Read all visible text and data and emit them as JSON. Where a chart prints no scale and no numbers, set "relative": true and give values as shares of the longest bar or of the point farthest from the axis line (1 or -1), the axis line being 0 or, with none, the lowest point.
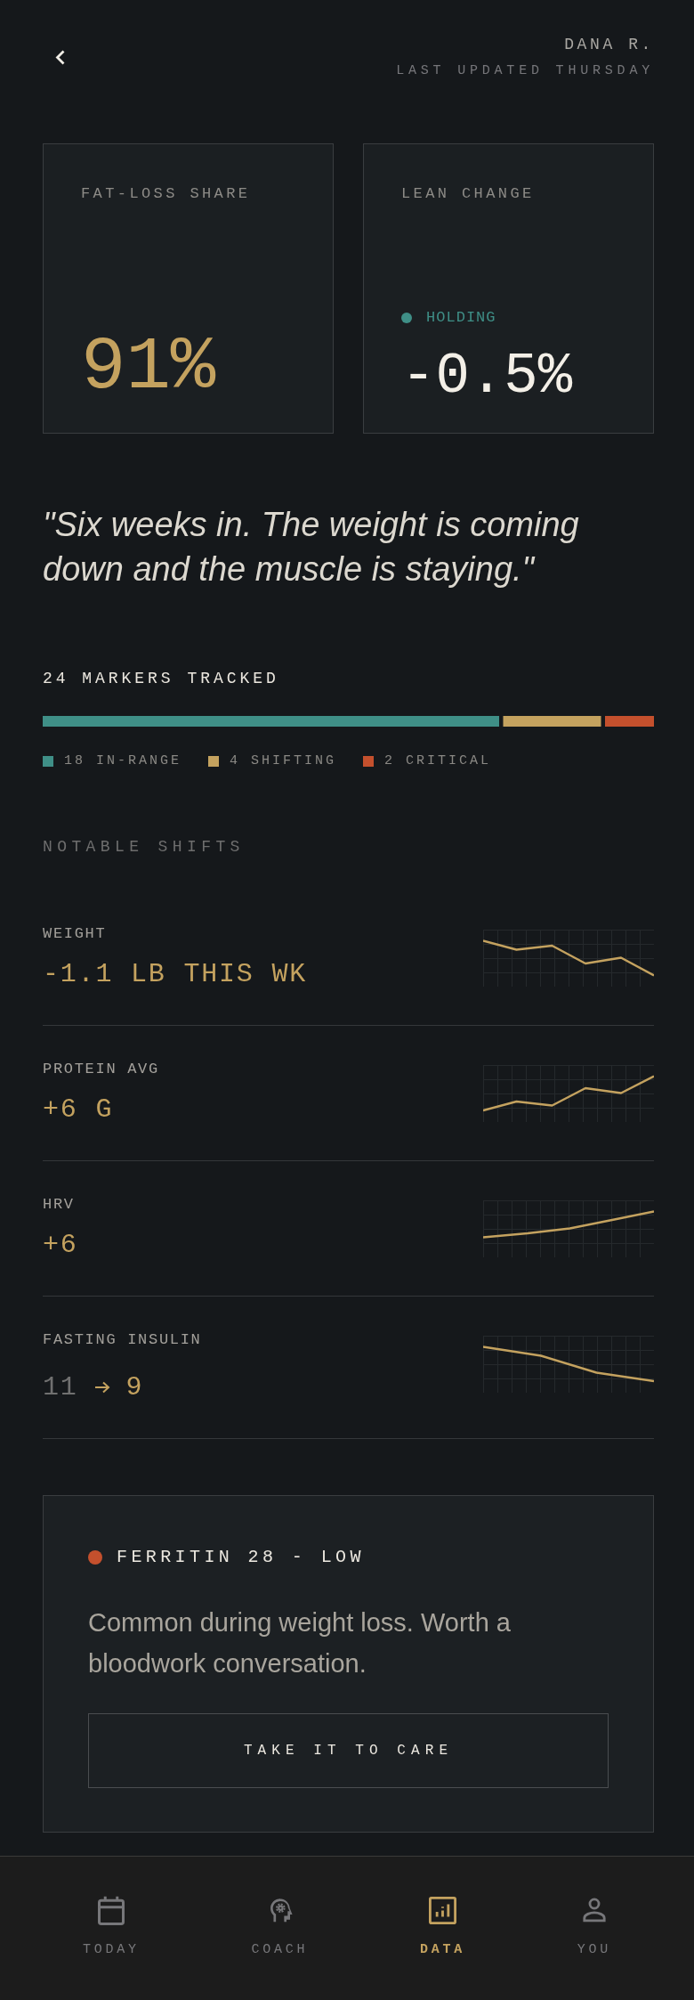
{
  "header": {
    "name": "DANA R.",
    "subtitle": "LAST UPDATED THURSDAY"
  },
  "stats": [
    {
      "kind": "highlight",
      "label": "FAT-LOSS SHARE",
      "value": "91%"
    },
    {
      "kind": "status",
      "label": "LEAN CHANGE",
      "status": {
        "label": "HOLDING",
        "color": "#3f8f87"
      },
      "value": "-0.5%"
    }
  ],
  "quote": "\"Six weeks in. The weight is coming down and the muscle is staying.\"",
  "markers": {
    "title": "24 MARKERS TRACKED",
    "chart_data": {
      "type": "bar",
      "orientation": "horizontal",
      "stacked": true,
      "relative": true,
      "legend": "bottom",
      "series": [
        {
          "name": "18 IN-RANGE",
          "color": "#3f8f87",
          "values": [
            0.75
          ]
        },
        {
          "name": "4 SHIFTING",
          "color": "#c4a25f",
          "values": [
            0.1667
          ]
        },
        {
          "name": "2 CRITICAL",
          "color": "#c4502d",
          "values": [
            0.0833
          ]
        }
      ]
    }
  },
  "notable_shifts": {
    "title": "NOTABLE SHIFTS",
    "rows": [
      {
        "kind": "delta",
        "label": "WEIGHT",
        "value": "-1.1 LB THIS WK"
      },
      {
        "kind": "delta",
        "label": "PROTEIN AVG",
        "value": "+6 G"
      },
      {
        "kind": "delta",
        "label": "HRV",
        "value": "+6"
      },
      {
        "kind": "change",
        "label": "FASTING INSULIN",
        "from": "11",
        "to": "9"
      }
    ]
  },
  "alert": {
    "color": "#c4502d",
    "title": "FERRITIN 28 - LOW",
    "body": "Common during weight loss. Worth a bloodwork conversation.",
    "action": "TAKE IT TO CARE"
  },
  "bottom_nav": [
    {
      "label": "TODAY",
      "selected": false
    },
    {
      "label": "COACH",
      "selected": false
    },
    {
      "label": "DATA",
      "selected": true
    },
    {
      "label": "YOU",
      "selected": false
    }
  ]
}
